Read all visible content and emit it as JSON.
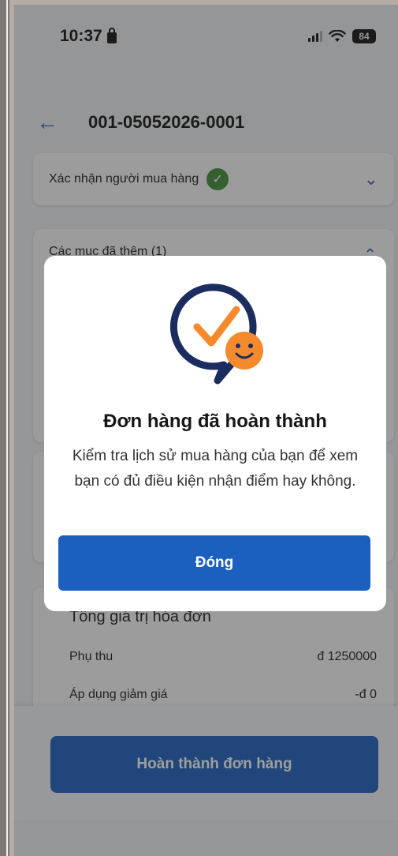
{
  "status_bar": {
    "time": "10:37",
    "battery": "84"
  },
  "header": {
    "title": "001-05052026-0001"
  },
  "confirm_section": {
    "label": "Xác nhận người mua hàng"
  },
  "items_section": {
    "title": "Các mục đã thêm (1)"
  },
  "totals": {
    "title": "Tổng giá trị hóa đơn",
    "rows": [
      {
        "label": "Phụ thu",
        "value": "đ 1250000"
      },
      {
        "label": "Áp dụng giảm giá",
        "value": "-đ  0"
      }
    ]
  },
  "footer": {
    "complete_label": "Hoàn thành đơn hàng"
  },
  "modal": {
    "title": "Đơn hàng đã hoàn thành",
    "message": "Kiểm tra lịch sử mua hàng của bạn để xem bạn có đủ điều kiện nhận điểm hay không.",
    "close_label": "Đóng"
  },
  "colors": {
    "primary": "#1b5fbf",
    "success": "#3f8f38",
    "accent_orange": "#f58a2d",
    "navy": "#1b2c5e"
  },
  "icons": [
    "back-arrow-icon",
    "check-circle-icon",
    "chevron-down-icon",
    "chevron-up-icon",
    "smiley-check-icon",
    "signal-icon",
    "wifi-icon",
    "battery-icon",
    "lock-icon"
  ]
}
